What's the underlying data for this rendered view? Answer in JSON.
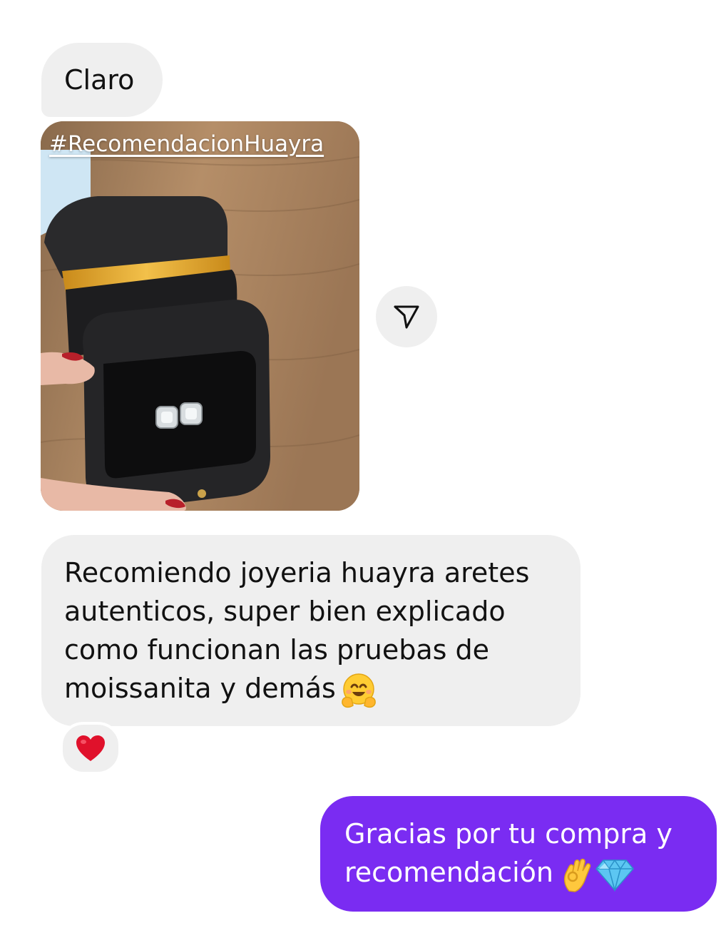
{
  "messages": {
    "claro": "Claro",
    "story": {
      "hashtag": "#RecomendacionHuayra"
    },
    "recommend": {
      "lines": [
        "Recomiendo joyeria huayra aretes",
        "autenticos, super bien explicado",
        "como funcionan las pruebas de",
        "moissanita y demás"
      ],
      "emoji": "hugging-face"
    },
    "reaction": "heart",
    "reply": {
      "lines": [
        "Gracias por tu compra y",
        "recomendación"
      ],
      "emojis": [
        "ok-hand",
        "gem-stone"
      ]
    }
  },
  "icons": {
    "share": "paper-plane-icon"
  },
  "colors": {
    "incoming_bubble": "#efefef",
    "outgoing_bubble": "#7a2cf2",
    "outgoing_text": "#ffffff"
  }
}
